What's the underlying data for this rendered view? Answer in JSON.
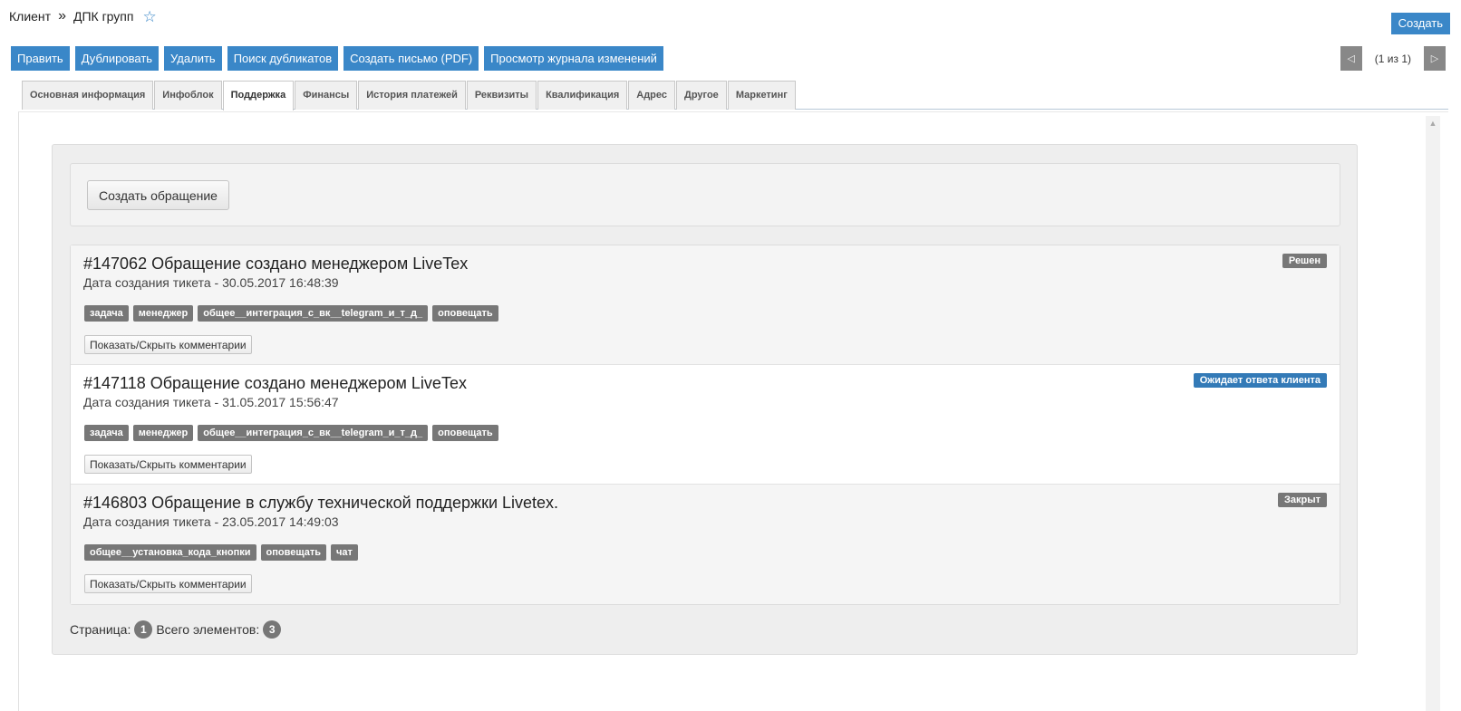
{
  "breadcrumb": {
    "root": "Клиент",
    "separator": "»",
    "current": "ДПК групп"
  },
  "header": {
    "create_label": "Создать"
  },
  "toolbar": {
    "buttons": [
      "Править",
      "Дублировать",
      "Удалить",
      "Поиск дубликатов",
      "Создать письмо (PDF)",
      "Просмотр журнала изменений"
    ]
  },
  "pager": {
    "label": "(1 из 1)"
  },
  "tabs": [
    "Основная информация",
    "Инфоблок",
    "Поддержка",
    "Финансы",
    "История платежей",
    "Реквизиты",
    "Квалификация",
    "Адрес",
    "Другое",
    "Маркетинг"
  ],
  "active_tab": "Поддержка",
  "support": {
    "create_ticket_label": "Создать обращение",
    "toggle_comments_label": "Показать/Скрыть комментарии",
    "tickets": [
      {
        "title": "#147062 Обращение создано менеджером LiveTex",
        "date": "Дата создания тикета - 30.05.2017 16:48:39",
        "status": "Решен",
        "status_color": "#777777",
        "tags": [
          "задача",
          "менеджер",
          "общее__интеграция_с_вк__telegram_и_т_д_",
          "оповещать"
        ]
      },
      {
        "title": "#147118 Обращение создано менеджером LiveTex",
        "date": "Дата создания тикета - 31.05.2017 15:56:47",
        "status": "Ожидает ответа клиента",
        "status_color": "#337ab7",
        "tags": [
          "задача",
          "менеджер",
          "общее__интеграция_с_вк__telegram_и_т_д_",
          "оповещать"
        ]
      },
      {
        "title": "#146803 Обращение в службу технической поддержки Livetex.",
        "date": "Дата создания тикета - 23.05.2017 14:49:03",
        "status": "Закрыт",
        "status_color": "#777777",
        "tags": [
          "общее__установка_кода_кнопки",
          "оповещать",
          "чат"
        ]
      }
    ],
    "footer": {
      "page_label": "Страница:",
      "page_value": "1",
      "total_label": "Всего элементов:",
      "total_value": "3"
    }
  },
  "colors": {
    "accent": "#3a87c8",
    "badge": "#777777"
  },
  "icons": {
    "favorite": "star-icon",
    "prev": "caret-left-icon",
    "next": "caret-right-icon"
  }
}
